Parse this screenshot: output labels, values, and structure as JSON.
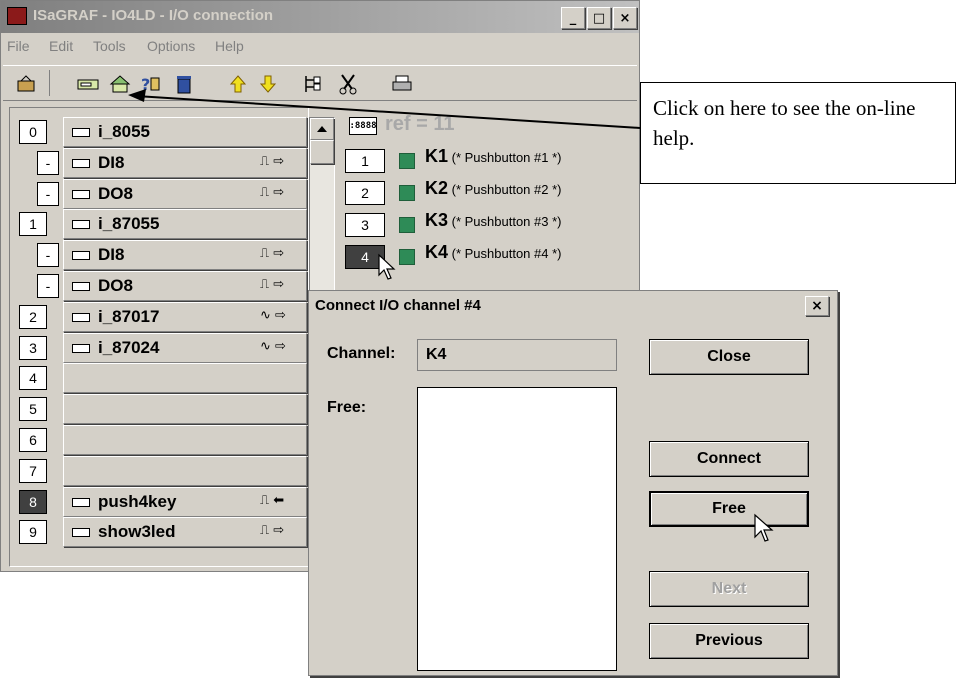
{
  "window": {
    "title": "ISaGRAF - IO4LD - I/O connection",
    "controls": {
      "minimize": "_",
      "maximize": "□",
      "close": "×"
    }
  },
  "menu": [
    "File",
    "Edit",
    "Tools",
    "Options",
    "Help"
  ],
  "toolbar_icons": [
    "open-icon",
    "connect-icon",
    "board-icon",
    "help-icon",
    "delete-icon",
    "up-arrow-icon",
    "down-arrow-icon",
    "tree-icon",
    "cut-icon",
    "print-icon"
  ],
  "slots": [
    {
      "num": "0",
      "name": "i_8055",
      "sym": ""
    },
    {
      "num": "-",
      "name": "DI8",
      "sym": "⎍ ⇨"
    },
    {
      "num": "-",
      "name": "DO8",
      "sym": "⎍ ⇨"
    },
    {
      "num": "1",
      "name": "i_87055",
      "sym": ""
    },
    {
      "num": "-",
      "name": "DI8",
      "sym": "⎍ ⇨"
    },
    {
      "num": "-",
      "name": "DO8",
      "sym": "⎍ ⇨"
    },
    {
      "num": "2",
      "name": "i_87017",
      "sym": "∿ ⇨"
    },
    {
      "num": "3",
      "name": "i_87024",
      "sym": "∿ ⇨"
    },
    {
      "num": "4",
      "name": "",
      "sym": ""
    },
    {
      "num": "5",
      "name": "",
      "sym": ""
    },
    {
      "num": "6",
      "name": "",
      "sym": ""
    },
    {
      "num": "7",
      "name": "",
      "sym": ""
    },
    {
      "num": "8",
      "name": "push4key",
      "sym": "⎍ ⬅"
    },
    {
      "num": "9",
      "name": "show3led",
      "sym": "⎍ ⇨"
    }
  ],
  "board_ref": {
    "code": ":8888",
    "label": "ref = 11"
  },
  "channels": [
    {
      "num": "1",
      "name": "K1",
      "comment": "(* Pushbutton #1 *)"
    },
    {
      "num": "2",
      "name": "K2",
      "comment": "(* Pushbutton #2 *)"
    },
    {
      "num": "3",
      "name": "K3",
      "comment": "(* Pushbutton #3 *)"
    },
    {
      "num": "4",
      "name": "K4",
      "comment": "(* Pushbutton #4 *)"
    }
  ],
  "callout": "Click on here to see the on-line help.",
  "dialog": {
    "title": "Connect I/O channel #4",
    "close_x": "×",
    "channel_label": "Channel:",
    "channel_value": "K4",
    "free_label": "Free:",
    "buttons": {
      "close": "Close",
      "connect": "Connect",
      "free": "Free",
      "next": "Next",
      "previous": "Previous"
    }
  }
}
